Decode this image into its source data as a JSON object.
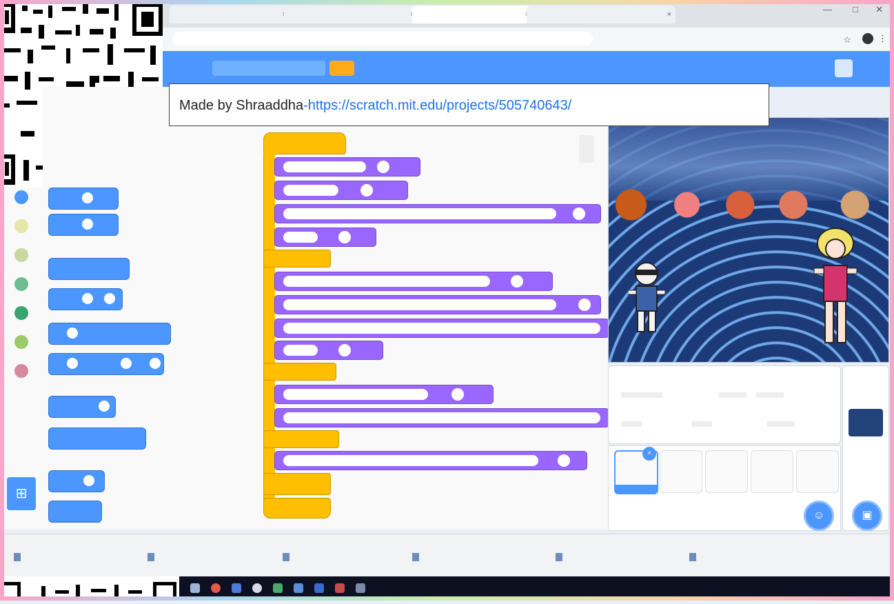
{
  "caption": {
    "author_text": "Made by Shraaddha",
    "link_text": "-https://scratch.mit.edu/projects/505740643/"
  },
  "browser": {
    "tabs": [
      "",
      "",
      "",
      ""
    ],
    "address": ""
  },
  "scratch_menu": {
    "title_box": "",
    "share_label": "",
    "see_project": "",
    "user": ""
  },
  "categories": [
    "",
    "",
    "",
    "",
    "",
    "",
    ""
  ],
  "script_area_label": "",
  "downloads": [
    "",
    "",
    "",
    "",
    "",
    ""
  ],
  "downloads_show_all": "",
  "icons": {
    "add_extension": "add-extension-icon",
    "add_sprite": "cat-icon",
    "add_backdrop": "image-icon"
  },
  "colors": {
    "scratch_blue": "#4c97ff",
    "looks_purple": "#9966ff",
    "events_yellow": "#ffbf00",
    "share_orange": "#ffab19"
  }
}
